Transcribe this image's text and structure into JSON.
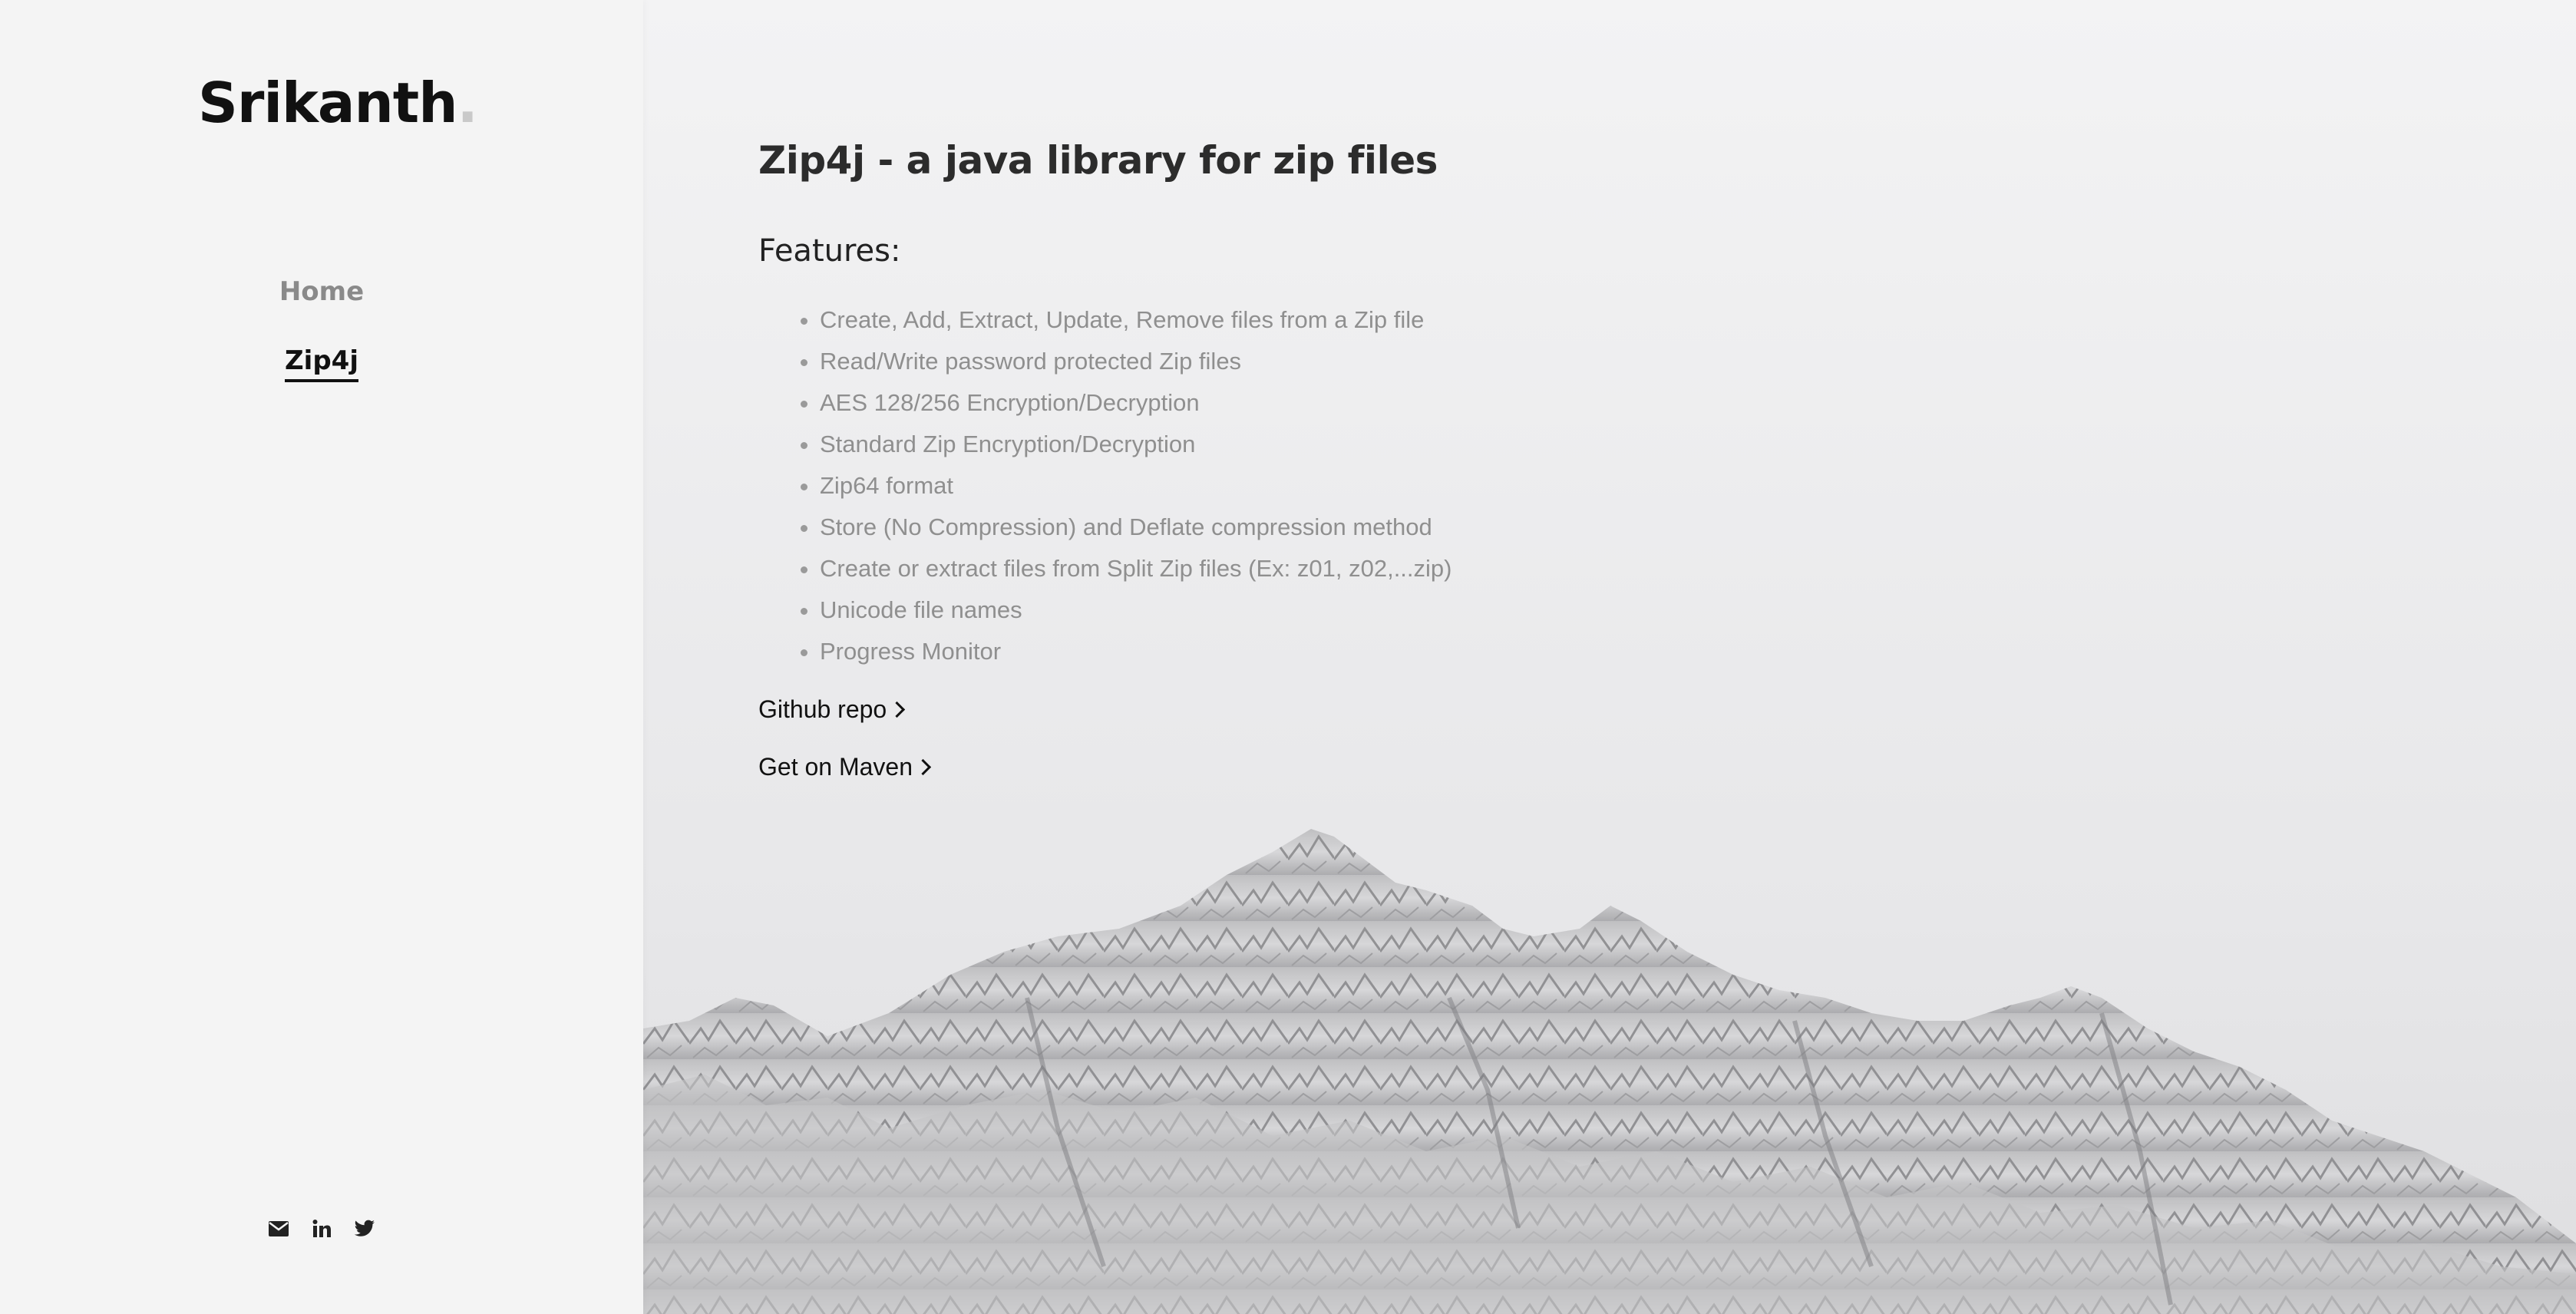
{
  "sidebar": {
    "logo_text": "Srikanth",
    "logo_dot": ".",
    "nav": [
      {
        "label": "Home"
      },
      {
        "label": "Zip4j"
      }
    ],
    "social_icons": [
      "email-icon",
      "linkedin-icon",
      "twitter-icon"
    ]
  },
  "main": {
    "title": "Zip4j - a java library for zip files",
    "features_heading": "Features:",
    "features": [
      "Create, Add, Extract, Update, Remove files from a Zip file",
      "Read/Write password protected Zip files",
      "AES 128/256 Encryption/Decryption",
      "Standard Zip Encryption/Decryption",
      "Zip64 format",
      "Store (No Compression) and Deflate compression method",
      "Create or extract files from Split Zip files (Ex: z01, z02,...zip)",
      "Unicode file names",
      "Progress Monitor"
    ],
    "github_link": "Github repo",
    "maven_link": "Get on Maven"
  },
  "colors": {
    "text_dark": "#111111",
    "text_muted": "#8f8f8f",
    "sidebar_bg": "#f4f4f4"
  }
}
